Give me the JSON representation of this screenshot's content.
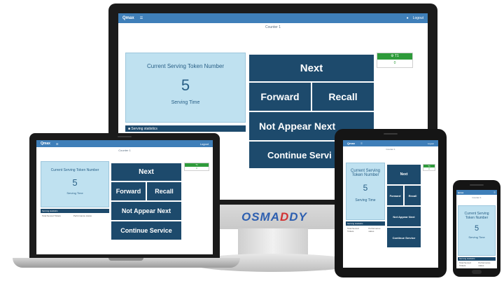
{
  "app": {
    "logo": "Qmax",
    "menu_icon": "hamburger-icon",
    "user_icon": "user-icon",
    "user_label": "Logout",
    "counter_label": "Counter 1",
    "token_title": "Current Serving Token Number",
    "token_value": "5",
    "serving_time_label": "Serving Time",
    "stats_title": "Serving statistics",
    "stats_col1": "Total Served Tickets",
    "stats_col2": "Performance status",
    "buttons": {
      "next": "Next",
      "forward": "Forward",
      "recall": "Recall",
      "not_appear": "Not Appear Next",
      "continue": "Continue Service"
    },
    "indicator": {
      "label": "T1",
      "value": "0",
      "color": "#2e9b3a"
    }
  },
  "desktop_buttons": {
    "next": "Next",
    "forward": "Forward",
    "recall": "Recall",
    "not_appear": "Not Appear Next",
    "continue": "Continue Servi"
  },
  "brand": {
    "part1": "OSMA",
    "part2": "D",
    "part3": "DY"
  },
  "colors": {
    "tile": "#1d4a6c",
    "card": "#bfe1f0",
    "appbar": "#3f7fb9"
  }
}
